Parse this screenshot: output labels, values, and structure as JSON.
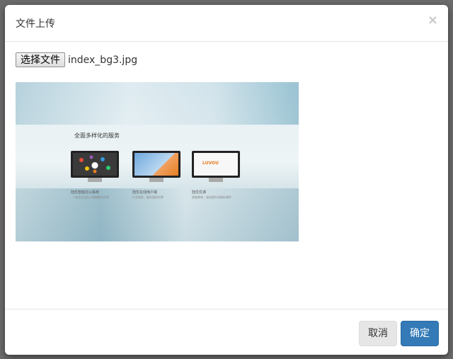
{
  "modal": {
    "title": "文件上传",
    "close_glyph": "×"
  },
  "file_input": {
    "button_label": "选择文件",
    "file_name": "index_bg3.jpg"
  },
  "preview": {
    "heading": "全面多样化的服务",
    "screen3_text": "LUVOU",
    "captions": [
      {
        "title": "陆优智能办公系统",
        "subtitle": "一体化企业办公智能解决方案"
      },
      {
        "title": "陆优在线用户端",
        "subtitle": "行业较好，能在服务世界"
      },
      {
        "title": "陆优优课",
        "subtitle": "智能教育，轻松提升机做好课件"
      }
    ]
  },
  "footer": {
    "cancel_label": "取消",
    "ok_label": "确定"
  },
  "colors": {
    "primary": "#337ab7",
    "cancel_bg": "#e6e6e6",
    "backdrop": "#6b6b6b"
  }
}
